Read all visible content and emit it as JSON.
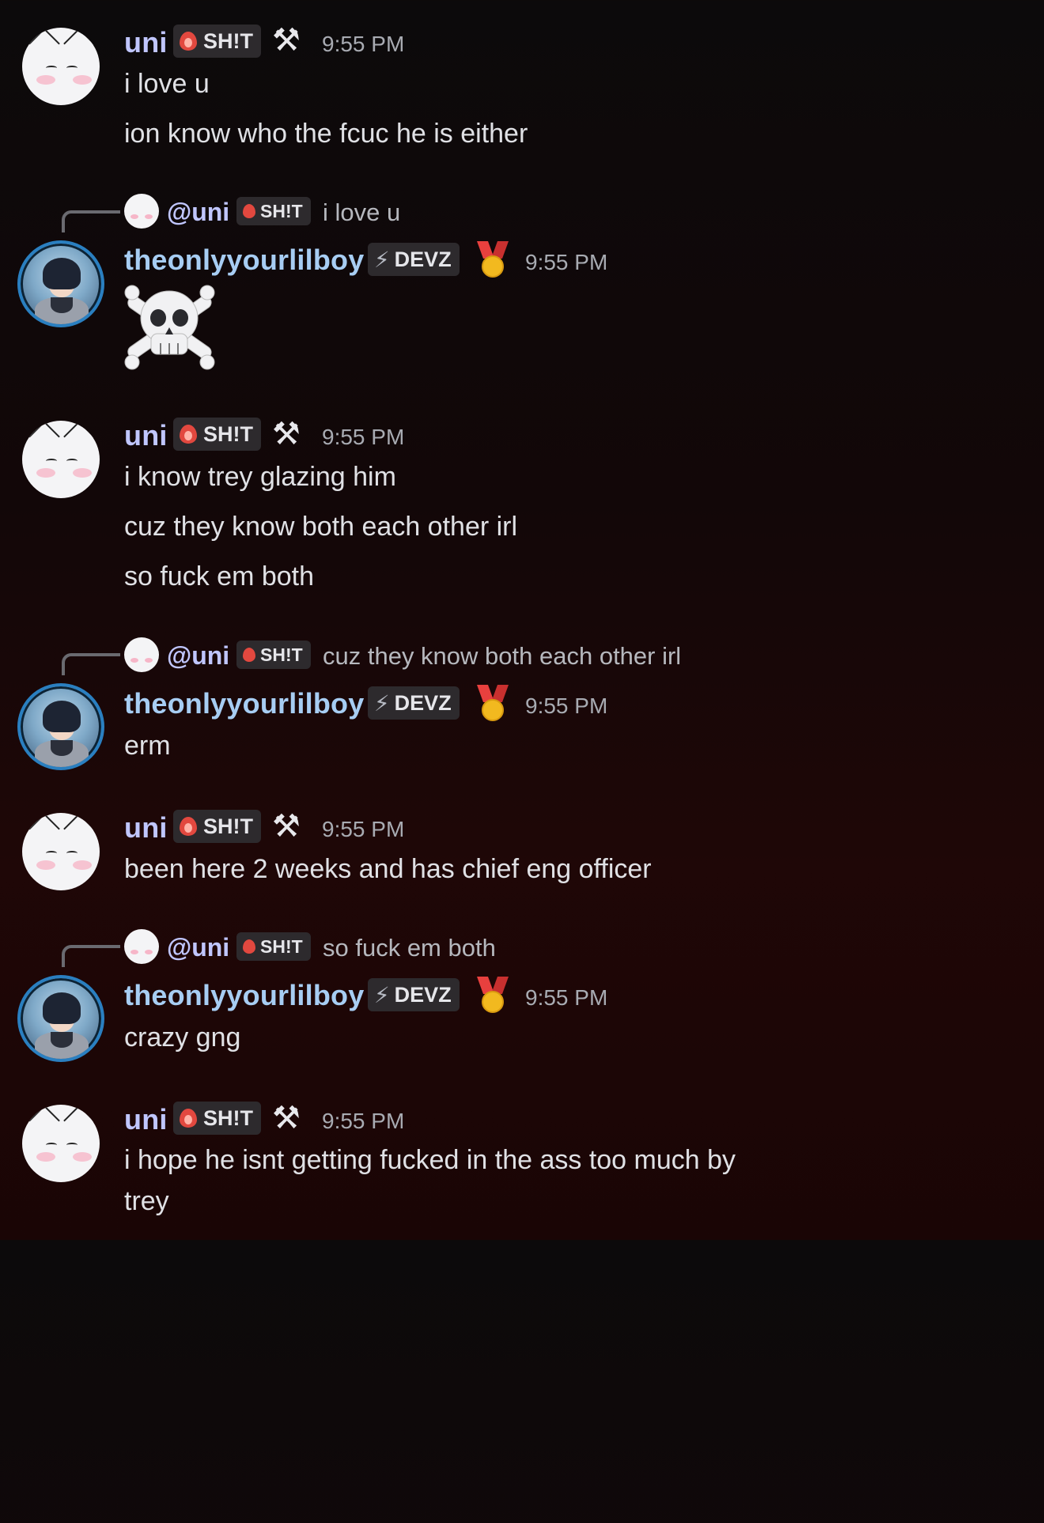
{
  "users": {
    "uni": {
      "name": "uni",
      "tag": "SH!T",
      "tools_icon": "hammer-and-pick-icon",
      "color": "#c0c6ff"
    },
    "boy": {
      "name": "theonlyyourlilboy",
      "tag": "DEVZ",
      "medal_icon": "medal-icon",
      "color": "#a7cdf3"
    }
  },
  "messages": [
    {
      "author": "uni",
      "time": "9:55 PM",
      "lines": [
        "i love u",
        "ion know who the fcuc he is either"
      ]
    },
    {
      "author": "theonlyyourlilboy",
      "time": "9:55 PM",
      "reply": {
        "mention": "@uni",
        "tag": "SH!T",
        "text": "i love u"
      },
      "emoji": "skull-and-crossbones"
    },
    {
      "author": "uni",
      "time": "9:55 PM",
      "lines": [
        "i know trey glazing him",
        "cuz they know both each other irl",
        "so fuck em both"
      ]
    },
    {
      "author": "theonlyyourlilboy",
      "time": "9:55 PM",
      "reply": {
        "mention": "@uni",
        "tag": "SH!T",
        "text": "cuz they know both each other irl"
      },
      "lines": [
        "erm"
      ]
    },
    {
      "author": "uni",
      "time": "9:55 PM",
      "lines": [
        "been here 2 weeks and has chief eng officer"
      ]
    },
    {
      "author": "theonlyyourlilboy",
      "time": "9:55 PM",
      "reply": {
        "mention": "@uni",
        "tag": "SH!T",
        "text": "so fuck em both"
      },
      "lines": [
        "crazy gng"
      ]
    },
    {
      "author": "uni",
      "time": "9:55 PM",
      "lines": [
        "i hope he isnt getting fucked in the ass too much by",
        "trey"
      ]
    }
  ]
}
